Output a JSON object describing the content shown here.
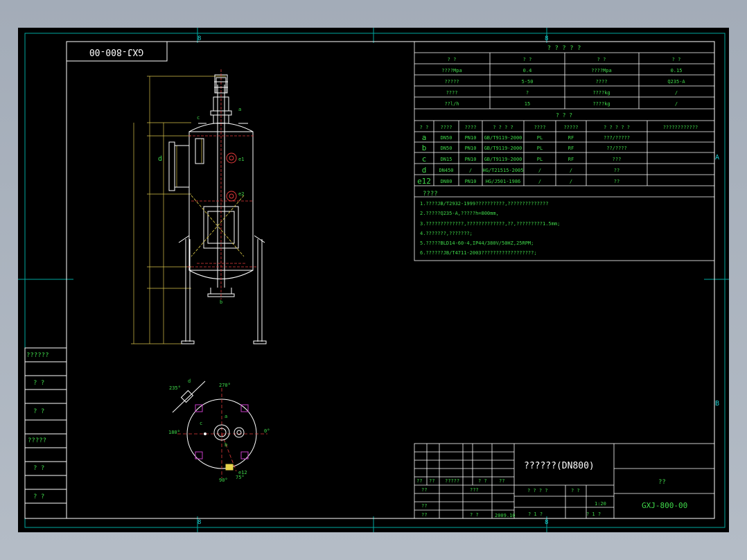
{
  "drawing": {
    "code_box": "GXJ-800-00",
    "zone_mark": "8"
  },
  "param_table": {
    "title": "? ? ? ? ?",
    "headers": [
      "? ?",
      "? ?",
      "? ?",
      "? ?"
    ],
    "rows": [
      [
        "????Mpa",
        "0.4",
        "????Mpa",
        "0.15"
      ],
      [
        "?????",
        "5-50",
        "????",
        "Q235-A"
      ],
      [
        "????",
        "?",
        "????kg",
        "/"
      ],
      [
        "??l/h",
        "15",
        "????kg",
        "/"
      ]
    ],
    "nozzle_title": "? ? ?",
    "nozzle_headers": [
      "? ?",
      "????",
      "????",
      "? ? ? ?",
      "????",
      "?????",
      "? ? ? ? ?",
      "????????????"
    ],
    "nozzles": [
      [
        "a",
        "DN50",
        "PN10",
        "GB/T9119-2000",
        "PL",
        "RF",
        "???/?????",
        ""
      ],
      [
        "b",
        "DN50",
        "PN10",
        "GB/T9119-2000",
        "PL",
        "RF",
        "??/????",
        ""
      ],
      [
        "c",
        "DN15",
        "PN10",
        "GB/T9119-2000",
        "PL",
        "RF",
        "???",
        ""
      ],
      [
        "d",
        "DN450",
        "/",
        "HG/T21515-2005",
        "/",
        "/",
        "??",
        ""
      ],
      [
        "e12",
        "DN80",
        "PN10",
        "HG/J501-1986",
        "/",
        "/",
        "??",
        ""
      ]
    ]
  },
  "notes": {
    "title": "????",
    "items": [
      "1.????JB/T2932-1999??????????,??????????????",
      "2.?????Q235-A,?????h=800mm,",
      "3.?????????????,?????????????,??,?????????1.5mm;",
      "4.???????,???????;",
      "5.?????BLD14-60-4,IP44/380V/50HZ,25RPM;",
      "6.??????JB/T4711-2003??????????????????;"
    ]
  },
  "elevation_labels": {
    "d": "d",
    "c": "c",
    "a": "a",
    "b": "b",
    "e1": "e1",
    "e2": "e2"
  },
  "plan_labels": {
    "a235": "235°",
    "a270": "270°",
    "a180": "180°",
    "a0": "0°",
    "a90": "90°",
    "a75": "75°",
    "d": "d",
    "c": "c",
    "a": "a",
    "b": "b",
    "e12": "e12"
  },
  "side_table": {
    "rows": [
      "??????",
      "? ?",
      "? ?",
      "?????",
      "? ?",
      "? ?"
    ]
  },
  "title_block": {
    "name": "??????(DN800)",
    "code": "GXJ-800-00",
    "company": "??",
    "scale": "1:20",
    "date": "2009.10",
    "cells": {
      "r1a": "??",
      "r1b": "??",
      "r1c": "?????",
      "r1d": "? ?",
      "r1e": "??",
      "r2a": "??",
      "r2b": "???",
      "r3a": "??",
      "r4a": "??",
      "r4b": "? ?",
      "mass": "? ? ? ?",
      "scale_h": "? ?",
      "sheet1": "? 1 ?",
      "sheet2": "? 1 ?"
    }
  },
  "zones": {
    "A": "A",
    "B": "B",
    "top": "8",
    "bottom": "8"
  }
}
